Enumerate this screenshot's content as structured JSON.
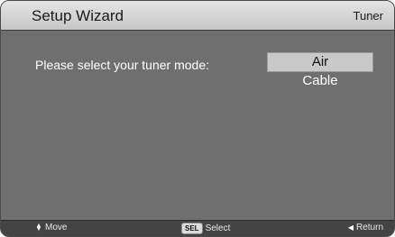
{
  "header": {
    "title": "Setup Wizard",
    "section": "Tuner"
  },
  "main": {
    "prompt": "Please select your tuner mode:",
    "options": [
      {
        "label": "Air",
        "selected": true
      },
      {
        "label": "Cable",
        "selected": false
      }
    ]
  },
  "footer": {
    "move_label": "Move",
    "select_key": "SEL",
    "select_label": "Select",
    "return_label": "Return"
  },
  "icons": {
    "move": "up-down-arrow-icon",
    "select": "sel-key-icon",
    "return": "left-arrow-icon"
  },
  "colors": {
    "header_bg": "#d6d6d6",
    "body_bg": "#6f6f6f",
    "footer_bg": "#444444",
    "selected_bg": "#c9c9c9"
  }
}
